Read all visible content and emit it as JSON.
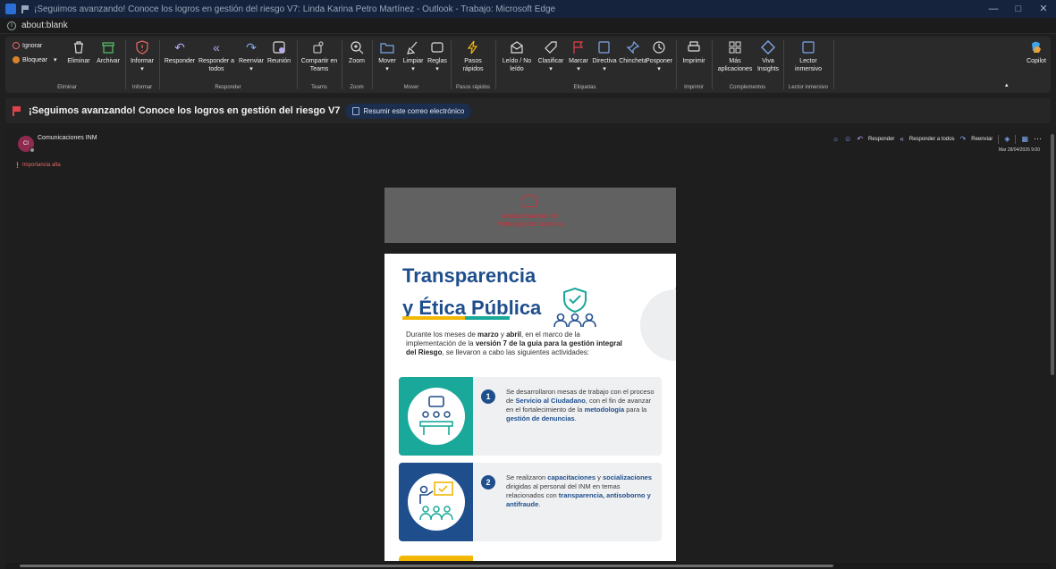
{
  "window": {
    "title": "¡Seguimos avanzando! Conoce los logros en gestión del riesgo V7: Linda Karina Petro Martínez - Outlook - Trabajo: Microsoft Edge",
    "controls": [
      "—",
      "□",
      "✕"
    ]
  },
  "address": {
    "url": "about:blank"
  },
  "ribbon": {
    "eliminar": {
      "ignore": "Ignorar",
      "block": "Bloquear",
      "delete": "Eliminar",
      "archive": "Archivar",
      "group": "Eliminar"
    },
    "informar": {
      "report": "Informar",
      "group": "Informar"
    },
    "responder": {
      "reply": "Responder",
      "reply_all": "Responder a todos",
      "forward": "Reenviar",
      "meeting": "Reunión",
      "group": "Responder"
    },
    "teams": {
      "share": "Compartir en Teams",
      "group": "Teams"
    },
    "zoom": {
      "zoom": "Zoom",
      "group": "Zoom"
    },
    "mover": {
      "move": "Mover",
      "clean": "Limpiar",
      "rules": "Reglas",
      "group": "Mover"
    },
    "pasos": {
      "quick": "Pasos rápidos",
      "group": "Pasos rápidos"
    },
    "etiquetas": {
      "read": "Leído / No leído",
      "classify": "Clasificar",
      "flag": "Marcar",
      "policy": "Directiva",
      "pin": "Chincheta",
      "snooze": "Posponer",
      "group": "Etiquetas"
    },
    "imprimir": {
      "print": "Imprimir",
      "group": "Imprimir"
    },
    "complementos": {
      "more_apps": "Más aplicaciones",
      "viva": "Viva Insights",
      "group": "Complementos"
    },
    "lector": {
      "reader": "Lector inmersivo",
      "group": "Lector inmersivo"
    },
    "copilot": "Copilot"
  },
  "subject": {
    "text": "¡Seguimos avanzando! Conoce los logros en gestión del riesgo V7",
    "summarize": "Resumir este correo electrónico"
  },
  "message": {
    "avatar_initials": "CI",
    "sender": "Comunicaciones INM",
    "importance": "Importancia alta",
    "actions": {
      "reply": "Responder",
      "reply_all": "Responder a todos",
      "forward": "Reenviar"
    },
    "datetime": "Mar 28/04/2026 9:00"
  },
  "email": {
    "header_org": [
      "Instituto Nacional de",
      "Metrología de Colombia"
    ],
    "title_line1": "Transparencia",
    "title_line2": "y Ética Pública",
    "intro": "Durante los meses de marzo y abril, en el marco de la implementación de la versión 7 de la guía para la gestión integral del Riesgo, se llevaron a cabo las siguientes actividades:",
    "cards": [
      {
        "num": "1",
        "color": "#1aa89a",
        "text": "Se desarrollaron mesas de trabajo con el proceso de Servicio al Ciudadano, con el fin de avanzar en el fortalecimiento de la metodología para la gestión de denuncias."
      },
      {
        "num": "2",
        "color": "#1f4e8c",
        "text": "Se realizaron capacitaciones y socializaciones dirigidas al personal del INM en temas relacionados con transparencia, antisoborno y antifraude."
      }
    ]
  },
  "colors": {
    "accent_yellow": "#f2b705",
    "brand_blue": "#1f4e8c",
    "teal": "#1aa89a",
    "flag_red": "#e0424b"
  }
}
